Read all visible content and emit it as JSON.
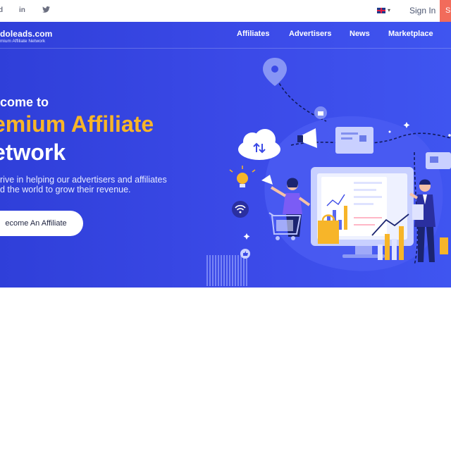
{
  "topbar": {
    "social": [
      {
        "name": "facebook",
        "glyph": "d"
      },
      {
        "name": "linkedin",
        "glyph": "in"
      },
      {
        "name": "twitter",
        "glyph": "t"
      }
    ],
    "language_icon": "uk-flag-icon",
    "signin_label": "Sign In",
    "signup_label": "S"
  },
  "header": {
    "logo_name": "doleads.com",
    "logo_tagline": "mium Affiliate Network",
    "nav": [
      "Affiliates",
      "Advertisers",
      "News",
      "Marketplace"
    ]
  },
  "hero": {
    "line1": "come to",
    "line2": "emium Affiliate",
    "line3": "etwork",
    "desc_line1": "rive in helping our advertisers and affiliates",
    "desc_line2": "d the world to grow their revenue.",
    "cta_label": "ecome An Affiliate"
  },
  "colors": {
    "hero_bg": "#3a49e6",
    "accent_yellow": "#f7b529",
    "signup_red": "#f26b5b"
  }
}
